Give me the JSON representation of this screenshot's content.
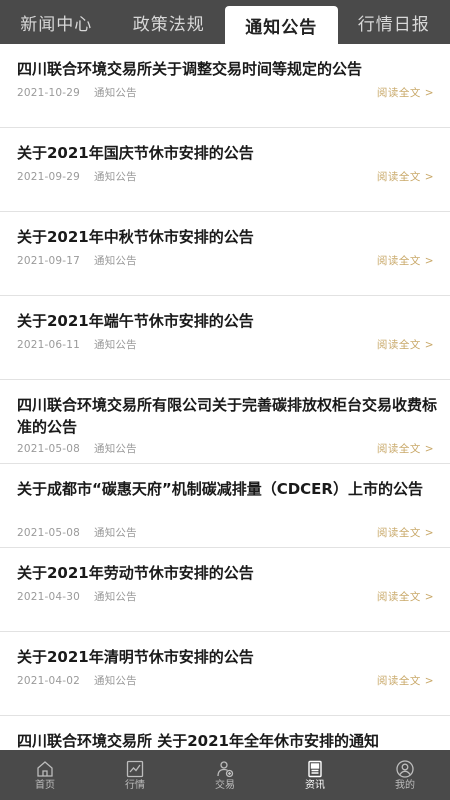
{
  "tabs": [
    {
      "label": "新闻中心"
    },
    {
      "label": "政策法规"
    },
    {
      "label": "通知公告"
    },
    {
      "label": "行情日报"
    }
  ],
  "active_tab": 2,
  "articles": [
    {
      "title": "四川联合环境交易所关于调整交易时间等规定的公告",
      "date": "2021-10-29",
      "category": "通知公告",
      "read_more": "阅读全文 >"
    },
    {
      "title": "关于2021年国庆节休市安排的公告",
      "date": "2021-09-29",
      "category": "通知公告",
      "read_more": "阅读全文 >"
    },
    {
      "title": "关于2021年中秋节休市安排的公告",
      "date": "2021-09-17",
      "category": "通知公告",
      "read_more": "阅读全文 >"
    },
    {
      "title": "关于2021年端午节休市安排的公告",
      "date": "2021-06-11",
      "category": "通知公告",
      "read_more": "阅读全文 >"
    },
    {
      "title": "四川联合环境交易所有限公司关于完善碳排放权柜台交易收费标准的公告",
      "date": "2021-05-08",
      "category": "通知公告",
      "read_more": "阅读全文 >"
    },
    {
      "title": "关于成都市“碳惠天府”机制碳减排量（CDCER）上市的公告",
      "date": "2021-05-08",
      "category": "通知公告",
      "read_more": "阅读全文 >"
    },
    {
      "title": "关于2021年劳动节休市安排的公告",
      "date": "2021-04-30",
      "category": "通知公告",
      "read_more": "阅读全文 >"
    },
    {
      "title": "关于2021年清明节休市安排的公告",
      "date": "2021-04-02",
      "category": "通知公告",
      "read_more": "阅读全文 >"
    },
    {
      "title": "四川联合环境交易所 关于2021年全年休市安排的通知",
      "date": "",
      "category": "",
      "read_more": ""
    }
  ],
  "bottom_nav": [
    {
      "label": "首页",
      "icon": "home-icon"
    },
    {
      "label": "行情",
      "icon": "chart-icon"
    },
    {
      "label": "交易",
      "icon": "trade-icon"
    },
    {
      "label": "资讯",
      "icon": "news-icon"
    },
    {
      "label": "我的",
      "icon": "profile-icon"
    }
  ],
  "active_nav": 3,
  "colors": {
    "bar_bg": "#4a4a4a",
    "accent_link": "#c9a96a",
    "title_text": "#1a1a1a",
    "meta_text": "#9a9a9a"
  }
}
